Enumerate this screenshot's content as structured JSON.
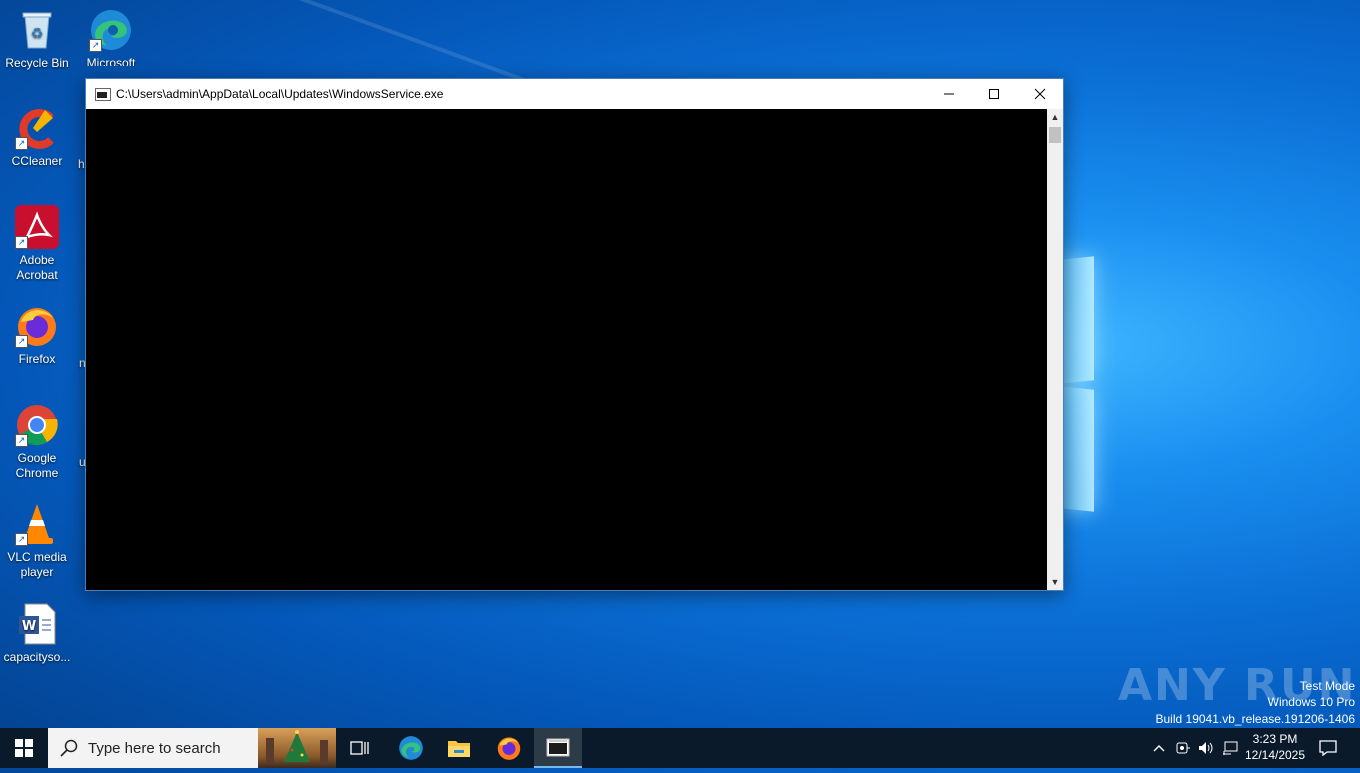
{
  "desktop": {
    "icons": [
      {
        "label": "Recycle Bin",
        "icon": "recycle-bin-icon"
      },
      {
        "label": "Microsoft Edge",
        "icon": "edge-icon"
      },
      {
        "label": "CCleaner",
        "icon": "ccleaner-icon"
      },
      {
        "label": "Adobe Acrobat",
        "icon": "acrobat-icon"
      },
      {
        "label": "Firefox",
        "icon": "firefox-icon"
      },
      {
        "label": "Google Chrome",
        "icon": "chrome-icon"
      },
      {
        "label": "VLC media player",
        "icon": "vlc-icon"
      },
      {
        "label": "capacityso...",
        "icon": "word-document-icon"
      }
    ],
    "partial_labels": [
      "h",
      "n",
      "u"
    ]
  },
  "window": {
    "title": "C:\\Users\\admin\\AppData\\Local\\Updates\\WindowsService.exe",
    "console_text": ""
  },
  "watermark": {
    "brand": "ANY RUN",
    "line1": "Test Mode",
    "line2": "Windows 10 Pro",
    "line3": "Build 19041.vb_release.191206-1406"
  },
  "taskbar": {
    "search_placeholder": "Type here to search",
    "apps": [
      "task-view",
      "edge",
      "file-explorer",
      "firefox",
      "console"
    ],
    "clock": {
      "time": "3:23 PM",
      "date": "12/14/2025"
    }
  },
  "colors": {
    "accent": "#76b9ed",
    "taskbar": "#0b1a2b",
    "console_bg": "#000000"
  }
}
